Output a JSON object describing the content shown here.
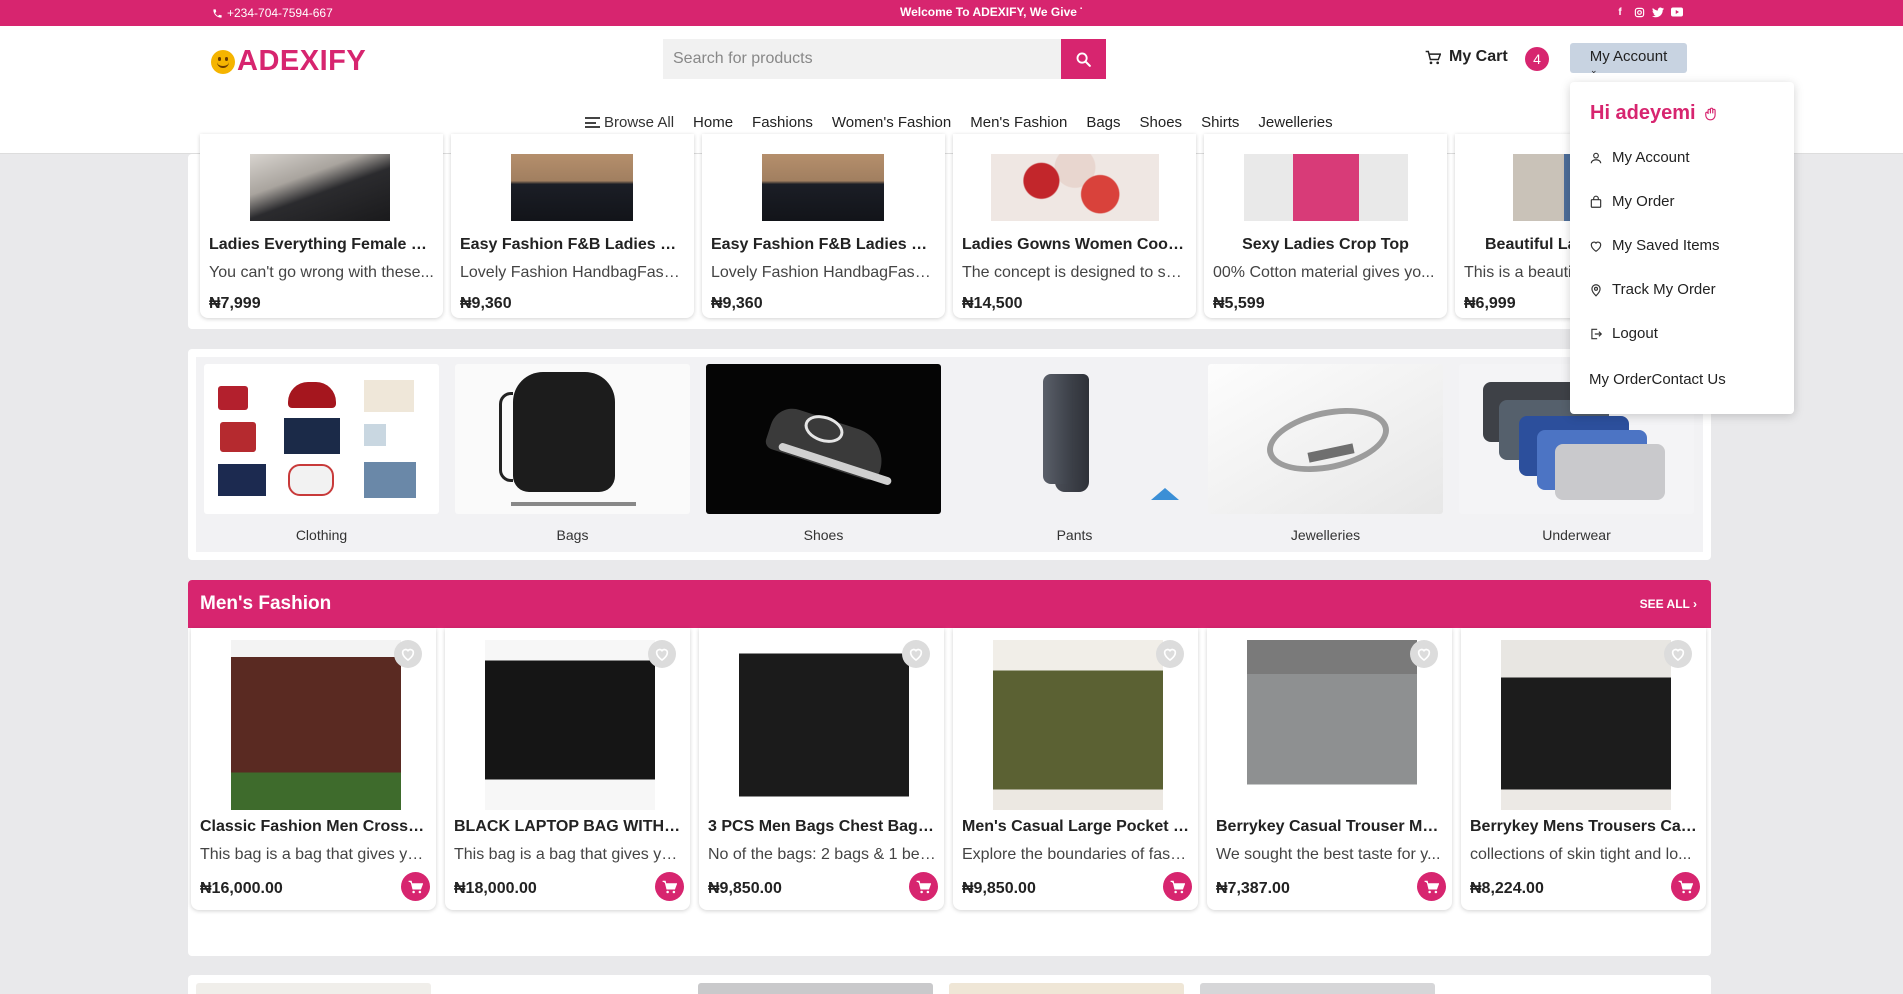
{
  "topbar": {
    "phone": "+234-704-7594-667",
    "welcome": "Welcome To ADEXIFY, We Give Th",
    "socials": [
      "facebook-icon",
      "instagram-icon",
      "twitter-icon",
      "youtube-icon"
    ]
  },
  "header": {
    "logo_text": "ADEXIFY",
    "search_placeholder": "Search for products",
    "cart_label": "My Cart",
    "cart_count": "4",
    "account_label": "My Account"
  },
  "nav": {
    "browse_all": "Browse All",
    "items": [
      "Home",
      "Fashions",
      "Women's Fashion",
      "Men's Fashion",
      "Bags",
      "Shoes",
      "Shirts",
      "Jewelleries"
    ]
  },
  "women_products": [
    {
      "title": "Ladies Everything Female Wo...",
      "desc": "You can't go wrong with these...",
      "price": "₦7,999"
    },
    {
      "title": "Easy Fashion F&B Ladies Han...",
      "desc": "Lovely Fashion HandbagFashi...",
      "price": "₦9,360"
    },
    {
      "title": "Easy Fashion F&B Ladies Han...",
      "desc": "Lovely Fashion HandbagFashi...",
      "price": "₦9,360"
    },
    {
      "title": "Ladies Gowns Women Coope...",
      "desc": "The concept is designed to sui...",
      "price": "₦14,500"
    },
    {
      "title": "Sexy Ladies Crop Top",
      "desc": "00% Cotton material gives yo...",
      "price": "₦5,599"
    },
    {
      "title": "Beautiful La",
      "desc": "This is a beautif",
      "price": "₦6,999"
    }
  ],
  "categories": [
    "Clothing",
    "Bags",
    "Shoes",
    "Pants",
    "Jewelleries",
    "Underwear"
  ],
  "mens_section": {
    "title": "Men's Fashion",
    "see_all": "SEE ALL"
  },
  "men_products": [
    {
      "title": "Classic Fashion Men Crossbod...",
      "desc": "This bag is a bag that gives yo...",
      "price": "₦16,000.00"
    },
    {
      "title": "BLACK LAPTOP BAG WITH A...",
      "desc": "This bag is a bag that gives yo...",
      "price": "₦18,000.00"
    },
    {
      "title": "3 PCS Men Bags Chest Bags C...",
      "desc": "No of the bags: 2 bags & 1 bel...",
      "price": "₦9,850.00"
    },
    {
      "title": "Men's Casual Large Pocket W...",
      "desc": "Explore the boundaries of fash...",
      "price": "₦9,850.00"
    },
    {
      "title": "Berrykey Casual Trouser Men ...",
      "desc": "We sought the best taste for y...",
      "price": "₦7,387.00"
    },
    {
      "title": "Berrykey Mens Trousers Casu...",
      "desc": "collections of skin tight and lo...",
      "price": "₦8,224.00"
    }
  ],
  "dropdown": {
    "greeting": "Hi adeyemi",
    "items": [
      "My Account",
      "My Order",
      "My Saved Items",
      "Track My Order",
      "Logout"
    ],
    "footer_link": "My OrderContact Us"
  },
  "colors": {
    "brand": "#d7256f",
    "account_button": "#c8d3e1",
    "page_bg": "#e9e9eb"
  }
}
